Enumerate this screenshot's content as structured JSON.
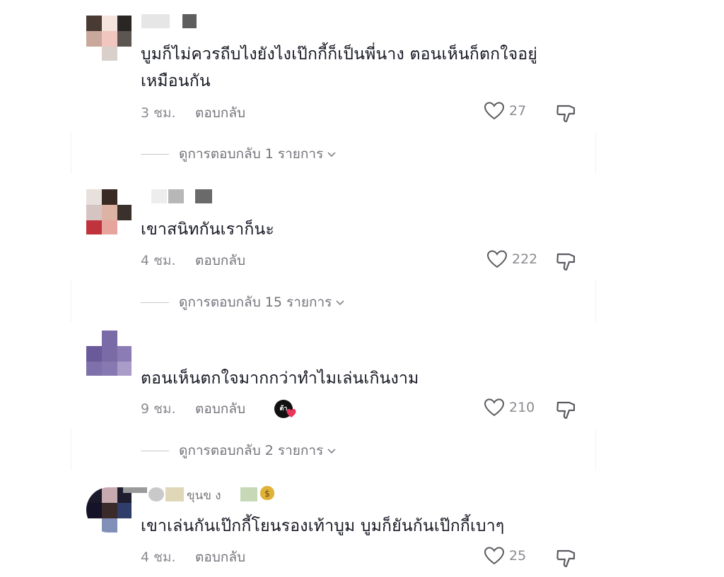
{
  "icons": {
    "like": "heart-outline-icon",
    "dislike": "thumbs-down-icon",
    "expand": "chevron-down-icon"
  },
  "colors": {
    "text": "#161823",
    "secondary": "#8a8b91",
    "like_heart": "#e8375a"
  },
  "comments": [
    {
      "text_line1": "บูมก็ไม่ควรถีบไงยังไงเป๊กกี้ก็เป็นพี่นาง ตอนเห็นก็ตกใจอยู่",
      "text_line2": "เหมือนกัน",
      "time": "3 ชม.",
      "reply_label": "ตอบกลับ",
      "likes": "27",
      "view_replies": "ดูการตอบกลับ 1 รายการ"
    },
    {
      "text_line1": "เขาสนิทกันเราก็นะ",
      "time": "4 ชม.",
      "reply_label": "ตอบกลับ",
      "likes": "222",
      "view_replies": "ดูการตอบกลับ 15 รายการ"
    },
    {
      "text_line1": "ตอนเห็นตกใจมากกว่าทำไมเล่นเกินงาม",
      "time": "9 ชม.",
      "reply_label": "ตอบกลับ",
      "creator_badge": "ต้า",
      "likes": "210",
      "view_replies": "ดูการตอบกลับ 2 รายการ"
    },
    {
      "username_partial": "ขุนข ง",
      "text_line1": "เขาเล่นกันเป๊กกี้โยนรองเท้าบูม บูมก็ยันก้นเป๊กกี้เบาๆ",
      "time": "4 ชม.",
      "reply_label": "ตอบกลับ",
      "likes": "25"
    }
  ]
}
